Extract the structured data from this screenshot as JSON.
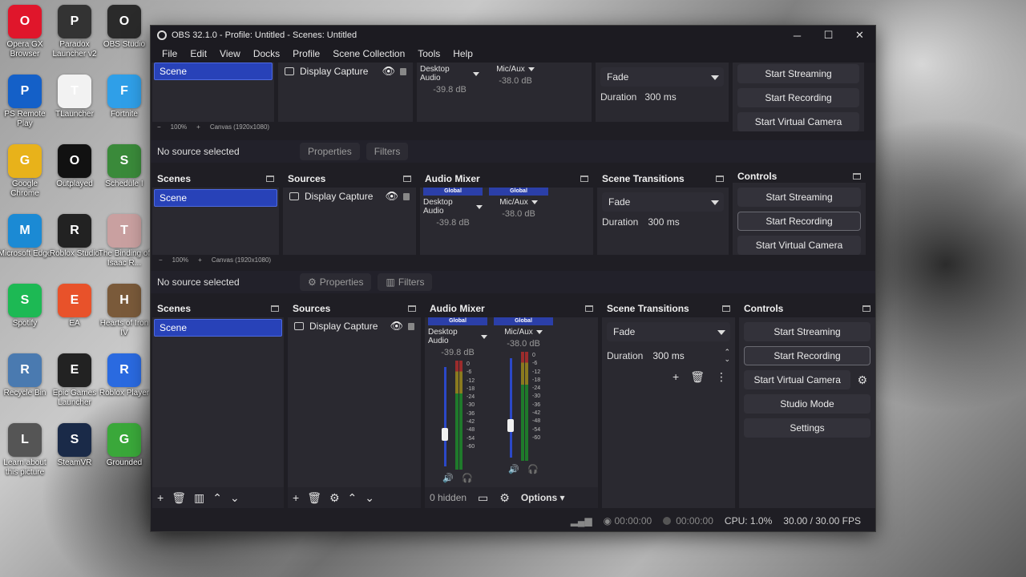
{
  "desktop": {
    "icons": [
      {
        "label": "Opera GX Browser",
        "icon": "opera-gx-icon",
        "color": "#e0162b"
      },
      {
        "label": "Paradox Launcher v2",
        "icon": "paradox-icon",
        "color": "#333333"
      },
      {
        "label": "OBS Studio",
        "icon": "obs-icon",
        "color": "#2a2a2a"
      },
      {
        "label": "PS Remote Play",
        "icon": "ps-remote-play-icon",
        "color": "#1460c8"
      },
      {
        "label": "TLauncher",
        "icon": "file-icon",
        "color": "#f2f2f2"
      },
      {
        "label": "Fortnite",
        "icon": "fortnite-icon",
        "color": "#2f9fe8"
      },
      {
        "label": "Google Chrome",
        "icon": "chrome-icon",
        "color": "#e8b21a"
      },
      {
        "label": "Outplayed",
        "icon": "outplayed-icon",
        "color": "#111111"
      },
      {
        "label": "Schedule I",
        "icon": "schedule-icon",
        "color": "#3a8a3a"
      },
      {
        "label": "Microsoft Edge",
        "icon": "edge-icon",
        "color": "#1b8ad4"
      },
      {
        "label": "Roblox Studio",
        "icon": "roblox-studio-icon",
        "color": "#222222"
      },
      {
        "label": "The Binding of Isaac R...",
        "icon": "isaac-icon",
        "color": "#c9a0a0"
      },
      {
        "label": "Spotify",
        "icon": "spotify-icon",
        "color": "#1db954"
      },
      {
        "label": "EA",
        "icon": "ea-icon",
        "color": "#e8522a"
      },
      {
        "label": "Hearts of Iron IV",
        "icon": "hoi-icon",
        "color": "#7a5a3a"
      },
      {
        "label": "Recycle Bin",
        "icon": "recycle-bin-icon",
        "color": "#4a7ab0"
      },
      {
        "label": "Epic Games Launcher",
        "icon": "epic-icon",
        "color": "#222222"
      },
      {
        "label": "Roblox Player",
        "icon": "roblox-icon",
        "color": "#2a6ae0"
      },
      {
        "label": "Learn about this picture",
        "icon": "camera-icon",
        "color": "#555555"
      },
      {
        "label": "SteamVR",
        "icon": "steamvr-icon",
        "color": "#1a2a48"
      },
      {
        "label": "Grounded",
        "icon": "grounded-icon",
        "color": "#3aa83a"
      }
    ]
  },
  "window": {
    "title": "OBS 32.1.0 - Profile: Untitled - Scenes: Untitled",
    "minimize": "─",
    "maximize": "☐",
    "close": "✕"
  },
  "menu": [
    "File",
    "Edit",
    "View",
    "Docks",
    "Profile",
    "Scene Collection",
    "Tools",
    "Help"
  ],
  "preview_bar": {
    "zoom": "100%",
    "canvas": "Canvas (1920x1080)"
  },
  "source_toolbar": {
    "no_source": "No source selected",
    "properties": "Properties",
    "filters": "Filters"
  },
  "docks": {
    "scenes": {
      "title": "Scenes",
      "items": [
        "Scene"
      ]
    },
    "sources": {
      "title": "Sources",
      "items": [
        "Display Capture"
      ]
    },
    "mixer": {
      "title": "Audio Mixer",
      "global_label": "Global",
      "channels": [
        {
          "name": "Desktop Audio",
          "db": "-39.8 dB"
        },
        {
          "name": "Mic/Aux",
          "db": "-38.0 dB"
        }
      ],
      "ticks": [
        "0",
        "-6",
        "-12",
        "-18",
        "-24",
        "-30",
        "-36",
        "-42",
        "-48",
        "-54",
        "-60"
      ],
      "hidden": "0 hidden",
      "options": "Options"
    },
    "transitions": {
      "title": "Scene Transitions",
      "selected": "Fade",
      "duration_label": "Duration",
      "duration_value": "300 ms"
    },
    "controls": {
      "title": "Controls",
      "start_streaming": "Start Streaming",
      "start_recording": "Start Recording",
      "start_virtual_camera": "Start Virtual Camera",
      "studio_mode": "Studio Mode",
      "settings": "Settings"
    }
  },
  "status": {
    "stream_time": "00:00:00",
    "rec_time": "00:00:00",
    "cpu": "CPU: 1.0%",
    "fps": "30.00 / 30.00 FPS"
  }
}
